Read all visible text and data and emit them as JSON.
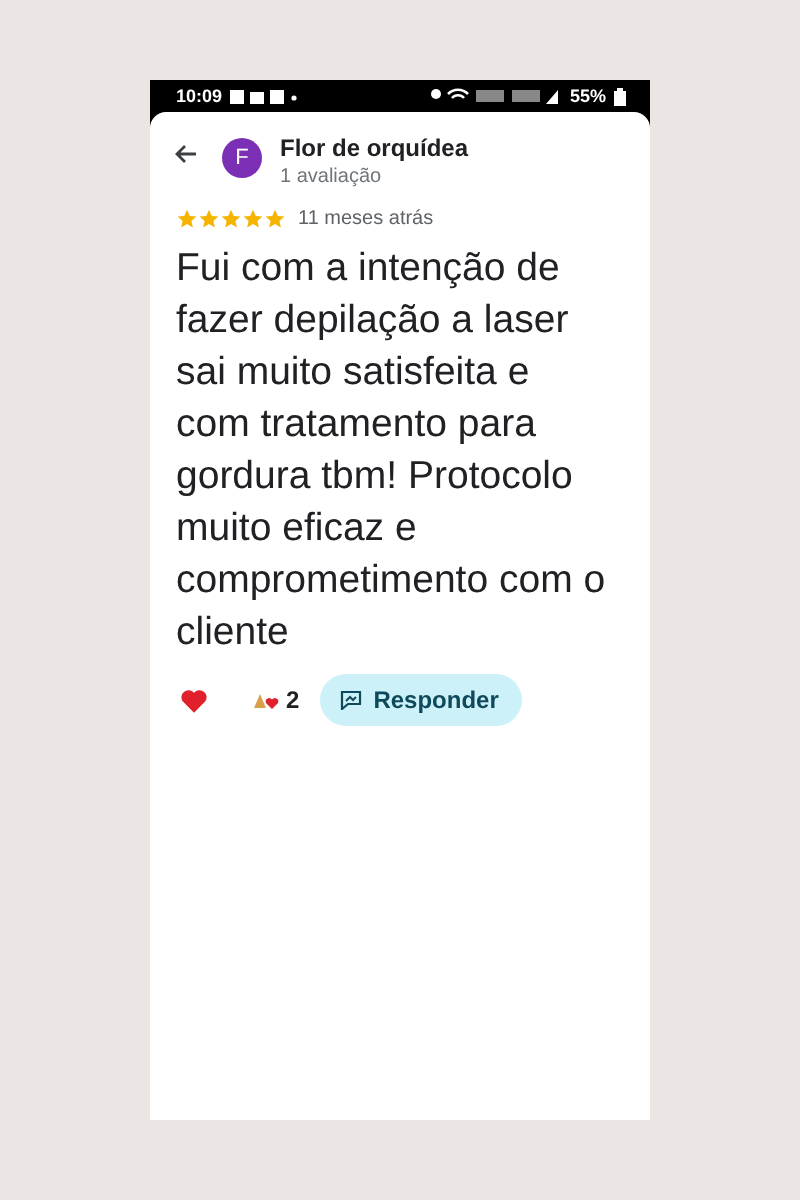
{
  "status_bar": {
    "time": "10:09",
    "battery": "55%"
  },
  "reviewer": {
    "initial": "F",
    "name": "Flor de orquídea",
    "count": "1 avaliação"
  },
  "review": {
    "stars": 5,
    "time": "11 meses atrás",
    "text": "Fui com a intenção de fazer depilação a laser sai muito satisfeita e com tratamento para gordura tbm! Protocolo muito eficaz e comprometimento com o cliente"
  },
  "reactions": {
    "count": "2",
    "reply_button": "Responder"
  }
}
